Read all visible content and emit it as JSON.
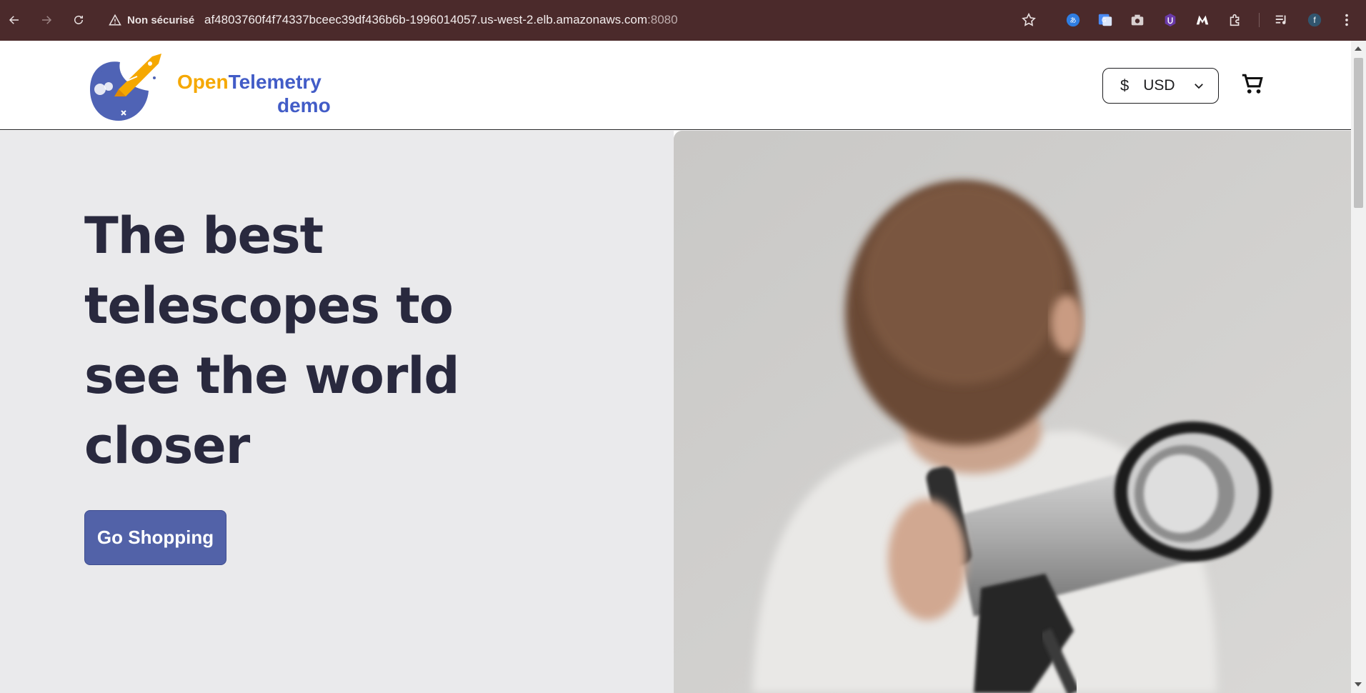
{
  "browser": {
    "security_label": "Non sécurisé",
    "url_host": "af4803760f4f74337bceec39df436b6b-1996014057.us-west-2.elb.amazonaws.com",
    "url_port": ":8080",
    "profile_initial": "f"
  },
  "header": {
    "logo_open": "Open",
    "logo_telemetry": "Telemetry",
    "logo_demo": "demo",
    "currency_symbol": "$",
    "currency_code": "USD"
  },
  "hero": {
    "title": "The best telescopes to see the world closer",
    "cta_label": "Go Shopping"
  },
  "colors": {
    "chrome": "#4b2a2b",
    "accent_button": "#5262a8",
    "logo_orange": "#f5a800",
    "logo_blue": "#425cc7",
    "hero_text": "#29293e"
  }
}
